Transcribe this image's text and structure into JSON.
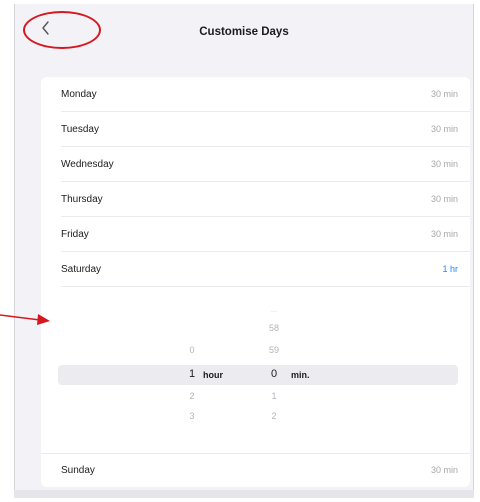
{
  "header": {
    "title": "Customise Days",
    "back_icon": "chevron-left-icon",
    "accent_color": "#1a8cff",
    "annotation_color": "#d7171f"
  },
  "days": [
    {
      "name": "Monday",
      "value": "30 min"
    },
    {
      "name": "Tuesday",
      "value": "30 min"
    },
    {
      "name": "Wednesday",
      "value": "30 min"
    },
    {
      "name": "Thursday",
      "value": "30 min"
    },
    {
      "name": "Friday",
      "value": "30 min"
    },
    {
      "name": "Saturday",
      "value": "1 hr"
    }
  ],
  "picker": {
    "hours": [
      "0",
      "1",
      "2",
      "3"
    ],
    "hour_unit": "hour",
    "minutes": [
      "58",
      "59",
      "0",
      "1",
      "2"
    ],
    "minute_unit": "min."
  },
  "sunday": {
    "name": "Sunday",
    "value": "30 min"
  }
}
